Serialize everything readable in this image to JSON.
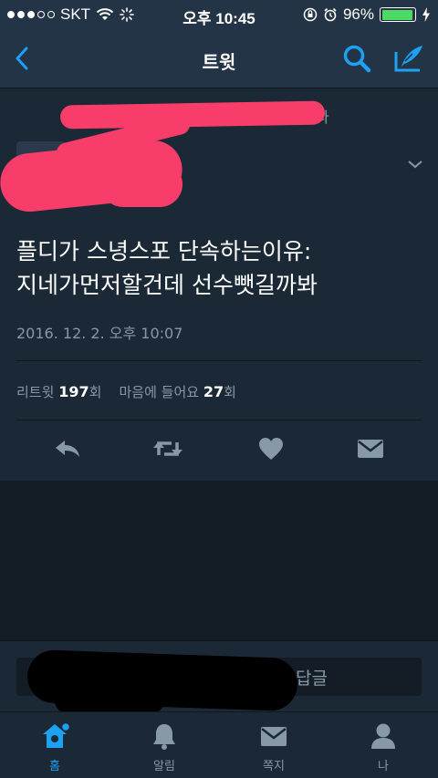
{
  "status_bar": {
    "carrier": "SKT",
    "time": "오후 10:45",
    "battery_percent": "96%",
    "battery_level": 0.96
  },
  "nav": {
    "title": "트윗",
    "back_icon": "chevron-left-icon",
    "search_icon": "search-icon",
    "compose_icon": "compose-icon"
  },
  "tweet": {
    "header_fragment": "다",
    "text_line1": "플디가 스녕스포 단속하는이유:",
    "text_line2": "지네가먼저할건데 선수뺏길까봐",
    "timestamp": "2016. 12. 2. 오후 10:07",
    "retweet_label": "리트윗",
    "retweet_count": "197",
    "retweet_suffix": "회",
    "like_label": "마음에 들어요",
    "like_count": "27",
    "like_suffix": "회"
  },
  "reply": {
    "placeholder": "답글"
  },
  "tabs": [
    {
      "label": "홈",
      "icon": "home-icon"
    },
    {
      "label": "알림",
      "icon": "bell-icon"
    },
    {
      "label": "쪽지",
      "icon": "mail-icon"
    },
    {
      "label": "나",
      "icon": "profile-icon"
    }
  ],
  "colors": {
    "accent": "#1da1f2",
    "background": "#141d26",
    "panel": "#1b2836",
    "redaction_pink": "#f93d6a"
  }
}
